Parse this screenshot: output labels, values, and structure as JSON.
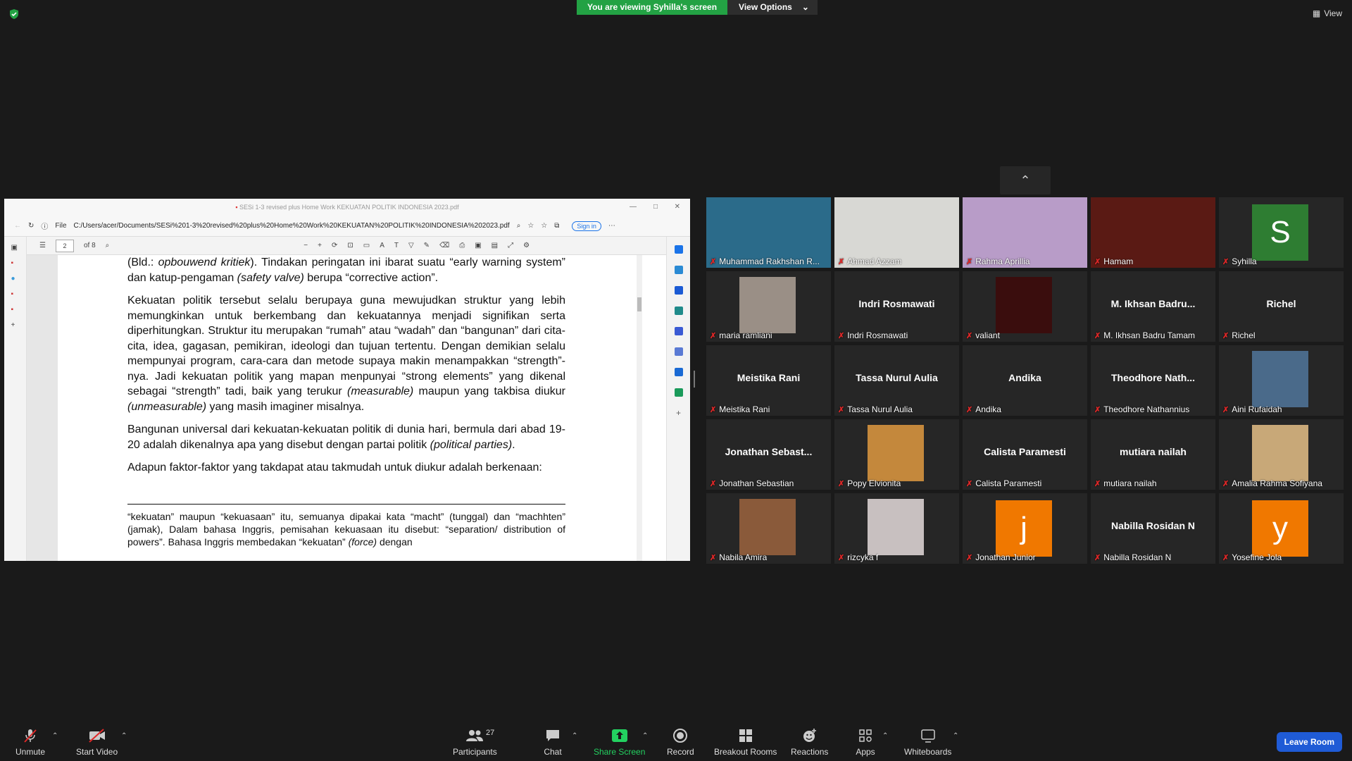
{
  "top": {
    "viewing_banner": "You are viewing Syhilla's screen",
    "view_options_label": "View Options",
    "view_label": "View"
  },
  "pdf": {
    "window_title": "SESi 1-3 revised plus Home Work KEKUATAN POLITIK INDONESIA 2023.pdf",
    "file_label": "File",
    "url": "C:/Users/acer/Documents/SESi%201-3%20revised%20plus%20Home%20Work%20KEKUATAN%20POLITIK%20INDONESIA%202023.pdf",
    "signin_label": "Sign in",
    "page_number": "2",
    "page_total": "of 8",
    "paragraphs": [
      {
        "pre": "(Bld.: ",
        "em": "opbouwend kritiek",
        "post": "). Tindakan peringatan ini ibarat suatu “early warning system” dan katup-pengaman ",
        "em2": "(safety valve)",
        "post2": " berupa “corrective action”."
      },
      {
        "pre": "Kekuatan politik tersebut selalu berupaya guna mewujudkan struktur yang lebih memungkinkan untuk berkembang dan kekuatannya menjadi signifikan serta diperhitungkan.   Struktur itu merupakan “rumah” atau “wadah” dan “bangunan” dari cita-cita, idea, gagasan, pemikiran, ideologi dan tujuan tertentu. Dengan demikian selalu mempunyai program, cara-cara dan metode supaya makin menampakkan “strength”-nya. Jadi kekuatan politik yang mapan menpunyai “strong elements” yang dikenal sebagai “strength” tadi, baik yang terukur ",
        "em": "(measurable)",
        "post": " maupun yang takbisa diukur ",
        "em2": "(unmeasurable)",
        "post2": "  yang masih imaginer misalnya."
      },
      {
        "pre": "Bangunan universal dari kekuatan-kekuatan politik di dunia hari, bermula dari abad 19-20 adalah dikenalnya apa yang disebut dengan partai politik ",
        "em": "(political parties)",
        "post": ".",
        "em2": "",
        "post2": ""
      },
      {
        "pre": "Adapun faktor-faktor yang takdapat atau takmudah untuk diukur adalah berkenaan:",
        "em": "",
        "post": "",
        "em2": "",
        "post2": ""
      }
    ],
    "footnote": {
      "pre": "“kekuatan” maupun “kekuasaan” itu, semuanya dipakai kata “macht” (tunggal) dan “machhten” (jamak), Dalam bahasa Inggris,  pemisahan kekuasaan itu disebut: “separation/ distribution of powers”. Bahasa Inggris membedakan “kekuatan” ",
      "em": "(force)",
      "post": "  dengan"
    }
  },
  "participants": [
    {
      "name": "Muhammad Rakhshan R...",
      "type": "video",
      "color": "#2b6b8a"
    },
    {
      "name": "Ahmad Azzam",
      "type": "video",
      "color": "#d8d8d4"
    },
    {
      "name": "Rahma Aprillia",
      "type": "video",
      "color": "#b89cc8"
    },
    {
      "name": "Hamam",
      "type": "video",
      "color": "#5a1a14"
    },
    {
      "name": "Syhilla",
      "type": "letter",
      "letter": "S",
      "color": "#2e7d32"
    },
    {
      "name": "maria ramliani",
      "type": "thumb",
      "color": "#9a8f86"
    },
    {
      "name": "Indri Rosmawati",
      "display": "Indri Rosmawati",
      "type": "name"
    },
    {
      "name": "valiant",
      "type": "thumb",
      "color": "#3a0d0d"
    },
    {
      "name": "M. Ikhsan Badru Tamam",
      "display": "M. Ikhsan Badru...",
      "type": "name"
    },
    {
      "name": "Richel",
      "display": "Richel",
      "type": "name"
    },
    {
      "name": "Meistika Rani",
      "display": "Meistika Rani",
      "type": "name"
    },
    {
      "name": "Tassa Nurul Aulia",
      "display": "Tassa Nurul Aulia",
      "type": "name"
    },
    {
      "name": "Andika",
      "display": "Andika",
      "type": "name"
    },
    {
      "name": "Theodhore Nathannius",
      "display": "Theodhore  Nath...",
      "type": "name"
    },
    {
      "name": "Aini Rufaidah",
      "type": "thumb",
      "color": "#4a6a8a"
    },
    {
      "name": "Jonathan Sebastian",
      "display": "Jonathan  Sebast...",
      "type": "name"
    },
    {
      "name": "Popy Elvionita",
      "type": "thumb",
      "color": "#c4883c"
    },
    {
      "name": "Calista Paramesti",
      "display": "Calista Paramesti",
      "type": "name"
    },
    {
      "name": "mutiara nailah",
      "display": "mutiara nailah",
      "type": "name"
    },
    {
      "name": "Amalia Rahma Sofiyana",
      "type": "thumb",
      "color": "#c8a878"
    },
    {
      "name": "Nabila Amira",
      "type": "thumb",
      "color": "#8a5a3a"
    },
    {
      "name": "rizcyka f",
      "type": "thumb",
      "color": "#c8c0c0"
    },
    {
      "name": "Jonathan Junior",
      "type": "letter",
      "letter": "j",
      "color": "#f07800"
    },
    {
      "name": "Nabilla Rosidan N",
      "display": "Nabilla Rosidan N",
      "type": "name"
    },
    {
      "name": "Yosefine Jola",
      "type": "letter",
      "letter": "y",
      "color": "#f07800"
    }
  ],
  "toolbar": {
    "unmute": "Unmute",
    "start_video": "Start Video",
    "participants": "Participants",
    "participants_count": "27",
    "chat": "Chat",
    "share_screen": "Share Screen",
    "record": "Record",
    "breakout_rooms": "Breakout Rooms",
    "reactions": "Reactions",
    "apps": "Apps",
    "whiteboards": "Whiteboards",
    "leave_room": "Leave Room"
  },
  "colors": {
    "share_green": "#23a244",
    "mic_off_red": "#e02828",
    "leave_blue": "#1f5bd6"
  }
}
